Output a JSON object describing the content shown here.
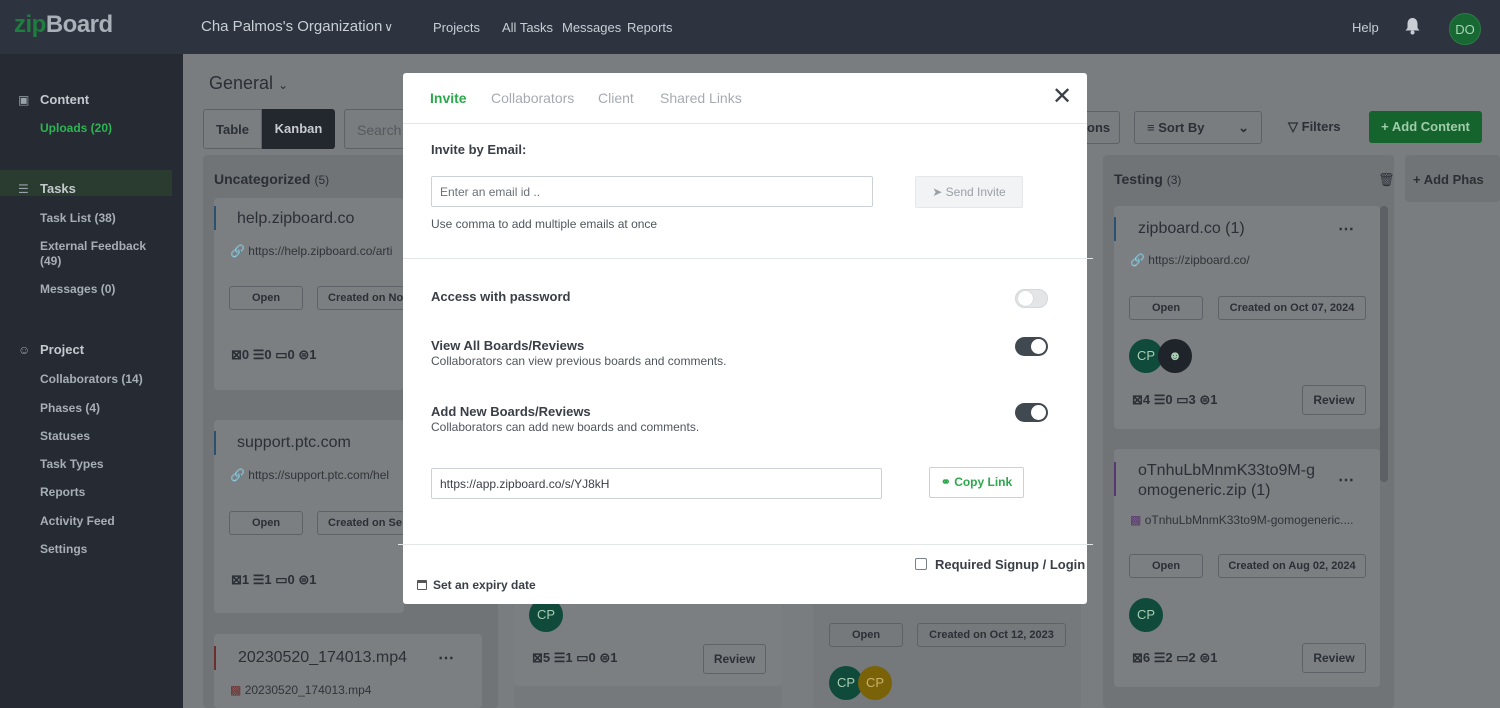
{
  "topbar": {
    "logo_zip": "zip",
    "logo_board": "Board",
    "org": "Cha Palmos's Organization",
    "nav": [
      "Projects",
      "All Tasks",
      "Messages",
      "Reports"
    ],
    "help": "Help",
    "avatar": "DO"
  },
  "sidebar": {
    "content_heading": "Content",
    "uploads": "Uploads (20)",
    "tasks_heading": "Tasks",
    "task_list": "Task List (38)",
    "external_feedback_1": "External Feedback",
    "external_feedback_2": "(49)",
    "messages": "Messages (0)",
    "project_heading": "Project",
    "collaborators": "Collaborators (14)",
    "phases": "Phases (4)",
    "statuses": "Statuses",
    "task_types": "Task Types",
    "reports": "Reports",
    "activity_feed": "Activity Feed",
    "settings": "Settings"
  },
  "board": {
    "title": "General",
    "view_table": "Table",
    "view_kanban": "Kanban",
    "search_placeholder": "Search",
    "options_fragment": "ons",
    "sort_by": "Sort By",
    "filters": "Filters",
    "add_content": "+ Add Content",
    "add_phase": "+ Add Phas",
    "columns": {
      "uncategorized": {
        "title": "Uncategorized",
        "count": "(5)"
      },
      "testing": {
        "title": "Testing",
        "count": "(3)"
      }
    },
    "cards": {
      "c1": {
        "title": "help.zipboard.co",
        "url": "https://help.zipboard.co/arti",
        "open": "Open",
        "created": "Created on No",
        "stats": "⊠0  ☰0  ▭0  ⊜1"
      },
      "c2": {
        "title": "support.ptc.com",
        "url": "https://support.ptc.com/hel",
        "open": "Open",
        "created": "Created on Se",
        "stats": "⊠1  ☰1  ▭0  ⊜1"
      },
      "c3": {
        "title": "20230520_174013.mp4",
        "file": "20230520_174013.mp4"
      },
      "c4": {
        "stats": "⊠5  ☰1  ▭0  ⊜1",
        "review": "Review",
        "avatar": "CP"
      },
      "c5": {
        "open": "Open",
        "created": "Created on Oct 12, 2023",
        "avatar1": "CP",
        "avatar2": "CP"
      },
      "t1": {
        "title": "zipboard.co (1)",
        "url": "https://zipboard.co/",
        "open": "Open",
        "created": "Created on Oct 07, 2024",
        "avatar": "CP",
        "stats": "⊠4  ☰0  ▭3  ⊜1",
        "review": "Review"
      },
      "t2": {
        "title_1": "oTnhuLbMnmK33to9M-g",
        "title_2": "omogeneric.zip (1)",
        "file": "oTnhuLbMnmK33to9M-gomogeneric....",
        "open": "Open",
        "created": "Created on Aug 02, 2024",
        "avatar": "CP",
        "stats": "⊠6  ☰2  ▭2  ⊜1",
        "review": "Review"
      }
    }
  },
  "modal": {
    "tabs": [
      "Invite",
      "Collaborators",
      "Client",
      "Shared Links"
    ],
    "invite_label": "Invite by Email:",
    "email_placeholder": "Enter an email id ..",
    "send_invite": "Send Invite",
    "comma_hint": "Use comma to add multiple emails at once",
    "access_password": "Access with password",
    "view_all_title": "View All Boards/Reviews",
    "view_all_desc": "Collaborators can view previous boards and comments.",
    "add_new_title": "Add New Boards/Reviews",
    "add_new_desc": "Collaborators can add new boards and comments.",
    "share_link": "https://app.zipboard.co/s/YJ8kH",
    "copy_link": "Copy Link",
    "required_signup": "Required Signup / Login",
    "expiry": "Set an expiry date",
    "toggles": {
      "access_password": false,
      "view_all": true,
      "add_new": true
    },
    "accent_color": "#2ea84c"
  }
}
